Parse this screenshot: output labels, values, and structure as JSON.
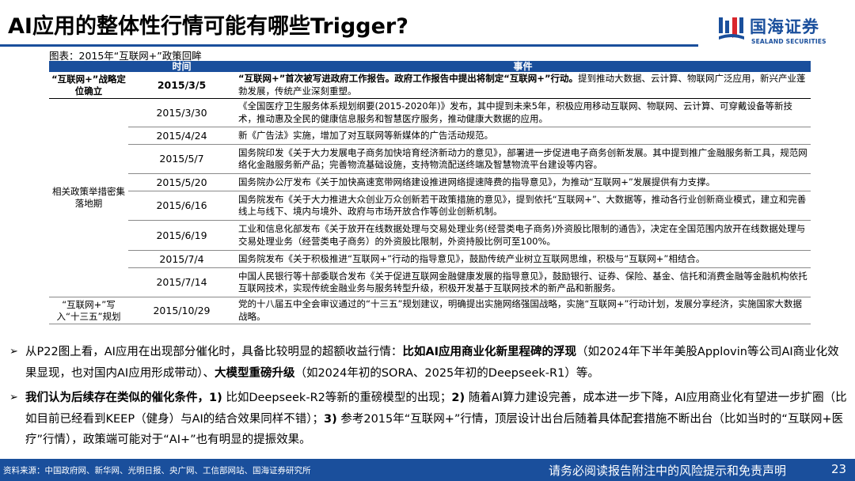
{
  "header": {
    "title": "AI应用的整体性行情可能有哪些Trigger?",
    "logo_cn": "国海证券",
    "logo_en": "SEALAND SECURITIES"
  },
  "caption": "图表：2015年“互联网+”政策回眸",
  "table": {
    "headers": [
      "时间",
      "事件"
    ],
    "categories": [
      "“互联网+”战略定位确立",
      "相关政策举措密集落地期",
      "“互联网+”写入“十三五”规划"
    ],
    "rows": [
      {
        "date": "2015/3/5",
        "event_bold": "“互联网+”首次被写进政府工作报告。政府工作报告中提出将制定“互联网+”行动。",
        "event": "提到推动大数据、云计算、物联网广泛应用，新兴产业蓬勃发展，传统产业深刻重塑。"
      },
      {
        "date": "2015/3/30",
        "event_bold": "",
        "event": "《全国医疗卫生服务体系规划纲要(2015-2020年)》发布，其中提到未来5年，积极应用移动互联网、物联网、云计算、可穿戴设备等新技术，推动惠及全民的健康信息服务和智慧医疗服务，推动健康大数据的应用。"
      },
      {
        "date": "2015/4/24",
        "event_bold": "",
        "event": "新《广告法》实施，增加了对互联网等新媒体的广告活动规范。"
      },
      {
        "date": "2015/5/7",
        "event_bold": "",
        "event": "国务院印发《关于大力发展电子商务加快培育经济新动力的意见》，部署进一步促进电子商务创新发展。其中提到推广金融服务新工具，规范网络化金融服务新产品；完善物流基础设施，支持物流配送终端及智慧物流平台建设等内容。"
      },
      {
        "date": "2015/5/20",
        "event_bold": "",
        "event": "国务院办公厅发布《关于加快高速宽带网络建设推进网络提速降费的指导意见》，为推动“互联网+”发展提供有力支撑。"
      },
      {
        "date": "2015/6/16",
        "event_bold": "",
        "event": "国务院发布《关于大力推进大众创业万众创新若干政策措施的意见》，提到依托“互联网+”、大数据等，推动各行业创新商业模式，建立和完善线上与线下、境内与境外、政府与市场开放合作等创业创新机制。"
      },
      {
        "date": "2015/6/19",
        "event_bold": "",
        "event": "工业和信息化部发布《关于放开在线数据处理与交易处理业务(经营类电子商务)外资股比限制的通告》，决定在全国范围内放开在线数据处理与交易处理业务（经营类电子商务）的外资股比限制，外资持股比例可至100%。"
      },
      {
        "date": "2015/7/4",
        "event_bold": "",
        "event": "国务院发布《关于积极推进“互联网+”行动的指导意见》，鼓励传统产业树立互联网思维，积极与“互联网+”相结合。"
      },
      {
        "date": "2015/7/14",
        "event_bold": "",
        "event": "中国人民银行等十部委联合发布《关于促进互联网金融健康发展的指导意见》，鼓励银行、证券、保险、基金、信托和消费金融等金融机构依托互联网技术，实现传统金融业务与服务转型升级，积极开发基于互联网技术的新产品和新服务。"
      },
      {
        "date": "2015/10/29",
        "event_bold": "",
        "event": "党的十八届五中全会审议通过的“十三五”规划建议，明确提出实施网络强国战略，实施“互联网+”行动计划，发展分享经济，实施国家大数据战略。"
      }
    ]
  },
  "bullets": [
    {
      "p1": "从P22图上看，AI应用在出现部分催化时，具备比较明显的超额收益行情：",
      "b1": "比如AI应用商业化新里程碑的浮现",
      "p2": "（如2024年下半年美股Applovin等公司AI商业化效果显现，也对国内AI应用形成带动）、",
      "b2": "大模型重磅升级",
      "p3": "（如2024年初的SORA、2025年初的Deepseek-R1）等。"
    },
    {
      "b1": "我们认为后续存在类似的催化条件，1)",
      "p1": " 比如Deepseek-R2等新的重磅模型的出现；",
      "b2": "2)",
      "p2": " 随着AI算力建设完善，成本进一步下降，AI应用商业化有望进一步扩圈（比如目前已经看到KEEP（健身）与AI的结合效果同样不错）；",
      "b3": "3)",
      "p3": " 参考2015年“互联网+”行情，顶层设计出台后随着具体配套措施不断出台（比如当时的“互联网+医疗”行情），政策端可能对于“AI+”也有明显的提振效果。"
    }
  ],
  "footer": {
    "source": "资料来源：中国政府网、新华网、光明日报、央广网、工信部网站、国海证券研究所",
    "disclaimer": "请务必阅读报告附注中的风险提示和免责声明",
    "page": "23"
  },
  "colors": {
    "brand": "#1a4f9c",
    "logo_accent": "#d9262c"
  }
}
